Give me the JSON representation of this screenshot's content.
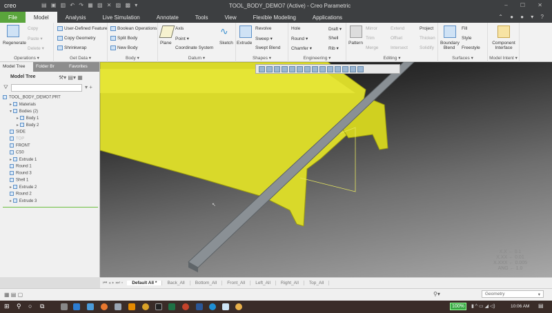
{
  "app": {
    "logo": "creo",
    "title": "TOOL_BODY_DEMO7 (Active) - Creo Parametric"
  },
  "tabs": [
    "File",
    "Model",
    "Analysis",
    "Live Simulation",
    "Annotate",
    "Tools",
    "View",
    "Flexible Modeling",
    "Applications"
  ],
  "ribbon": {
    "operations": {
      "label": "Operations ▾",
      "regenerate": "Regenerate",
      "copy": "Copy",
      "paste": "Paste ▾",
      "delete": "Delete ▾"
    },
    "get_data": {
      "label": "Get Data ▾",
      "udf": "User-Defined Feature",
      "copy_geometry": "Copy Geometry",
      "shrinkwrap": "Shrinkwrap"
    },
    "body": {
      "label": "Body ▾",
      "boolean": "Boolean Operations",
      "split": "Split Body",
      "new": "New Body"
    },
    "datum": {
      "label": "Datum ▾",
      "plane": "Plane",
      "axis": "Axis",
      "point": "Point ▾",
      "csys": "Coordinate System",
      "sketch": "Sketch"
    },
    "shapes": {
      "label": "Shapes ▾",
      "extrude": "Extrude",
      "revolve": "Revolve",
      "sweep": "Sweep ▾",
      "swept_blend": "Swept Blend"
    },
    "engineering": {
      "label": "Engineering ▾",
      "hole": "Hole",
      "round": "Round ▾",
      "chamfer": "Chamfer ▾",
      "draft": "Draft ▾",
      "shell": "Shell",
      "rib": "Rib ▾"
    },
    "editing": {
      "label": "Editing ▾",
      "pattern": "Pattern",
      "mirror": "Mirror",
      "trim": "Trim",
      "merge": "Merge",
      "extend": "Extend",
      "offset": "Offset",
      "intersect": "Intersect",
      "project": "Project",
      "thicken": "Thicken",
      "solidify": "Solidify"
    },
    "surfaces": {
      "label": "Surfaces ▾",
      "boundary_blend": "Boundary Blend",
      "fill": "Fill",
      "style": "Style",
      "freestyle": "Freestyle"
    },
    "model_intent": {
      "label": "Model Intent ▾",
      "component_interface": "Component Interface"
    }
  },
  "panel": {
    "tabs": [
      "Model Tree",
      "Folder Br",
      "Favorites"
    ],
    "header": "Model Tree",
    "filter_placeholder": "",
    "tree": [
      "TOOL_BODY_DEMO7.PRT",
      "Materials",
      "Bodies (2)",
      "Body 1",
      "Body 2",
      "SIDE",
      "TOP",
      "FRONT",
      "CS0",
      "Extrude 1",
      "Round 1",
      "Round 3",
      "Shell 1",
      "Extrude 2",
      "Round 2",
      "Extrude 3"
    ]
  },
  "viewport": {
    "tolerances": [
      "X.X ← 0.1",
      "X.XX ← 0.01",
      "X.XXX ← 0.005",
      "ANG ← 1.0"
    ],
    "model_color": "#e6e62a"
  },
  "view_tabs": [
    "Default All *",
    "Back_All",
    "Bottom_All",
    "Front_All",
    "Left_All",
    "Right_All",
    "Top_All"
  ],
  "status": {
    "filter": "Geometry"
  },
  "taskbar": {
    "battery": "100%",
    "time": "10:06 AM"
  }
}
